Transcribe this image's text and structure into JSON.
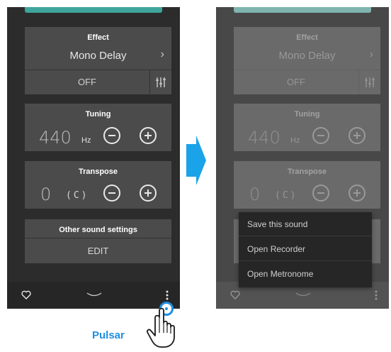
{
  "left_panel": {
    "effect": {
      "title": "Effect",
      "value": "Mono Delay",
      "state": "OFF"
    },
    "tuning": {
      "title": "Tuning",
      "value": "440",
      "unit": "Hz"
    },
    "transpose": {
      "title": "Transpose",
      "value": "0",
      "key": "(C)"
    },
    "other": {
      "title": "Other sound settings",
      "button": "EDIT"
    }
  },
  "right_panel": {
    "effect": {
      "title": "Effect",
      "value": "Mono Delay",
      "state": "OFF"
    },
    "tuning": {
      "title": "Tuning",
      "value": "440",
      "unit": "Hz"
    },
    "transpose": {
      "title": "Transpose",
      "value": "0",
      "key": "(C)"
    },
    "menu": [
      "Save this sound",
      "Open Recorder",
      "Open Metronome"
    ]
  },
  "instruction": {
    "label": "Pulsar"
  },
  "colors": {
    "accent": "#1f8fe2",
    "teal": "#3fa59c"
  }
}
